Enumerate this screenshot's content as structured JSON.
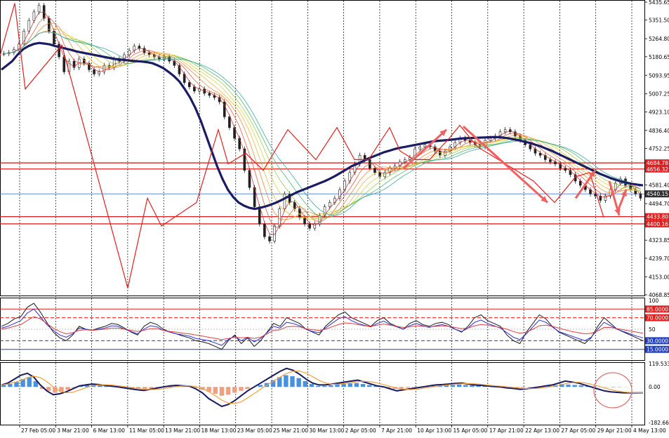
{
  "colors": {
    "background": "#ffffff",
    "grid": "#000000",
    "level_red": "#e02020",
    "zigzag": "#e02020",
    "arrow": "#f06060",
    "ma_slow": "#1c1c64",
    "price_line": "#4a78d8",
    "rsi_fast": "#1a1a1a",
    "rsi_mid": "#3030d0",
    "rsi_slow": "#e04040",
    "macd_line": "#1a1a60",
    "signal_line": "#f0a040",
    "hist_pos": "#4a90e0",
    "hist_neg": "#f0a080",
    "circle": "#e07070"
  },
  "chart_data": [
    {
      "type": "candlestick",
      "panel": "main",
      "ylim": [
        4068.85,
        5435.65
      ],
      "y_ticks": [
        "5435.65",
        "5351.50",
        "5264.80",
        "5180.65",
        "5093.95",
        "5007.25",
        "4923.10",
        "4836.40",
        "4752.25",
        "4665.55",
        "4581.40",
        "4494.70",
        "4410.55",
        "4323.85",
        "4239.70",
        "4153.00",
        "4068.85"
      ],
      "tags": [
        {
          "label": "4684.78",
          "value": 4684.78,
          "style": "red"
        },
        {
          "label": "4656.32",
          "value": 4656.32,
          "style": "red"
        },
        {
          "label": "4540.15",
          "value": 4540.15,
          "style": "dark"
        },
        {
          "label": "4433.80",
          "value": 4433.8,
          "style": "red"
        },
        {
          "label": "4400.16",
          "value": 4400.16,
          "style": "red"
        }
      ],
      "close": [
        5195,
        5200,
        5215,
        5240,
        5300,
        5350,
        5390,
        5420,
        5360,
        5300,
        5240,
        5180,
        5110,
        5160,
        5130,
        5170,
        5150,
        5120,
        5100,
        5110,
        5140,
        5130,
        5170,
        5160,
        5190,
        5210,
        5230,
        5220,
        5200,
        5190,
        5180,
        5170,
        5180,
        5160,
        5140,
        5100,
        5060,
        5040,
        5020,
        5030,
        5010,
        5000,
        4990,
        4970,
        4900,
        4850,
        4800,
        4750,
        4650,
        4570,
        4480,
        4400,
        4340,
        4320,
        4390,
        4470,
        4540,
        4500,
        4470,
        4430,
        4400,
        4380,
        4400,
        4440,
        4480,
        4500,
        4520,
        4560,
        4600,
        4640,
        4680,
        4720,
        4700,
        4660,
        4640,
        4620,
        4640,
        4660,
        4670,
        4690,
        4700,
        4710,
        4750,
        4760,
        4770,
        4760,
        4740,
        4720,
        4740,
        4760,
        4780,
        4800,
        4790,
        4780,
        4770,
        4760,
        4790,
        4800,
        4810,
        4830,
        4840,
        4830,
        4810,
        4790,
        4770,
        4750,
        4730,
        4720,
        4700,
        4690,
        4680,
        4660,
        4650,
        4630,
        4600,
        4580,
        4560,
        4540,
        4530,
        4510,
        4530,
        4560,
        4590,
        4610,
        4580,
        4560,
        4540,
        4520
      ],
      "ma_slow": [
        5120,
        5140,
        5160,
        5190,
        5215,
        5230,
        5240,
        5245,
        5242,
        5238,
        5230,
        5225,
        5218,
        5212,
        5205,
        5200,
        5195,
        5190,
        5185,
        5180,
        5175,
        5170,
        5168,
        5165,
        5162,
        5160,
        5158,
        5155,
        5150,
        5140,
        5128,
        5110,
        5090,
        5065,
        5030,
        4990,
        4940,
        4880,
        4810,
        4740,
        4670,
        4610,
        4560,
        4525,
        4500,
        4485,
        4475,
        4470,
        4475,
        4482,
        4490,
        4500,
        4512,
        4525,
        4538,
        4550,
        4560,
        4570,
        4580,
        4590,
        4600,
        4612,
        4625,
        4640,
        4655,
        4670,
        4680,
        4692,
        4705,
        4715,
        4725,
        4735,
        4742,
        4750,
        4756,
        4760,
        4765,
        4770,
        4775,
        4780,
        4785,
        4788,
        4790,
        4792,
        4795,
        4798,
        4800,
        4801,
        4802,
        4803,
        4804,
        4805,
        4805,
        4803,
        4800,
        4795,
        4790,
        4784,
        4778,
        4770,
        4762,
        4752,
        4742,
        4730,
        4718,
        4706,
        4694,
        4682,
        4670,
        4658,
        4646,
        4634,
        4624,
        4614,
        4606,
        4598,
        4592,
        4587,
        4583,
        4580
      ],
      "zigzag": [
        [
          0,
          5185
        ],
        [
          21,
          5430
        ],
        [
          36,
          5030
        ],
        [
          88,
          5235
        ],
        [
          182,
          4100
        ],
        [
          210,
          4520
        ],
        [
          230,
          4390
        ],
        [
          280,
          4500
        ],
        [
          311,
          4840
        ],
        [
          325,
          4680
        ],
        [
          350,
          4730
        ],
        [
          375,
          4650
        ],
        [
          410,
          4840
        ],
        [
          450,
          4700
        ],
        [
          480,
          4850
        ],
        [
          505,
          4700
        ],
        [
          525,
          4700
        ],
        [
          555,
          4850
        ],
        [
          570,
          4740
        ],
        [
          590,
          4700
        ],
        [
          612,
          4700
        ],
        [
          640,
          4800
        ],
        [
          655,
          4860
        ],
        [
          680,
          4760
        ],
        [
          720,
          4680
        ],
        [
          760,
          4600
        ],
        [
          790,
          4500
        ],
        [
          820,
          4620
        ],
        [
          840,
          4640
        ],
        [
          860,
          4430
        ]
      ],
      "arrows": [
        [
          [
            575,
            4660
          ],
          [
            636,
            4840
          ]
        ],
        [
          [
            660,
            4855
          ],
          [
            780,
            4500
          ]
        ],
        [
          [
            820,
            4520
          ],
          [
            848,
            4650
          ]
        ],
        [
          [
            868,
            4600
          ],
          [
            882,
            4440
          ]
        ],
        [
          [
            880,
            4460
          ],
          [
            892,
            4560
          ]
        ]
      ]
    },
    {
      "type": "line",
      "panel": "rsi",
      "ylim": [
        0,
        100
      ],
      "y_ticks": [
        "100",
        "50"
      ],
      "levels": [
        {
          "label": "85.0000",
          "value": 85,
          "color": "red",
          "dash": false
        },
        {
          "label": "70.0000",
          "value": 70,
          "color": "red",
          "dash": true
        },
        {
          "label": "30.0000",
          "value": 30,
          "color": "blue",
          "dash": true
        },
        {
          "label": "15.0000",
          "value": 15,
          "color": "blue",
          "dash": false
        }
      ],
      "series": [
        {
          "values": [
            55,
            60,
            68,
            72,
            88,
            95,
            80,
            62,
            45,
            35,
            30,
            40,
            55,
            50,
            48,
            52,
            55,
            60,
            58,
            52,
            45,
            40,
            55,
            62,
            58,
            50,
            45,
            42,
            38,
            35,
            30,
            28,
            25,
            20,
            15,
            30,
            40,
            25,
            35,
            20,
            30,
            45,
            60,
            55,
            70,
            65,
            60,
            50,
            45,
            40,
            55,
            65,
            75,
            80,
            70,
            65,
            60,
            55,
            65,
            70,
            60,
            55,
            50,
            60,
            65,
            58,
            55,
            60,
            62,
            58,
            50,
            45,
            55,
            70,
            75,
            65,
            60,
            55,
            40,
            30,
            25,
            45,
            60,
            75,
            68,
            55,
            45,
            40,
            35,
            30,
            25,
            35,
            55,
            70,
            60,
            50,
            45,
            40,
            35,
            30
          ]
        },
        {
          "values": [
            52,
            55,
            60,
            65,
            78,
            85,
            72,
            58,
            48,
            40,
            36,
            42,
            52,
            50,
            48,
            50,
            52,
            56,
            55,
            50,
            46,
            42,
            50,
            56,
            54,
            48,
            45,
            42,
            40,
            38,
            34,
            32,
            30,
            26,
            22,
            32,
            38,
            30,
            36,
            28,
            34,
            44,
            55,
            52,
            62,
            60,
            56,
            50,
            46,
            44,
            52,
            60,
            68,
            72,
            65,
            60,
            57,
            54,
            60,
            64,
            58,
            54,
            50,
            56,
            60,
            56,
            53,
            56,
            58,
            55,
            50,
            46,
            52,
            62,
            66,
            60,
            56,
            52,
            44,
            36,
            32,
            42,
            54,
            66,
            62,
            54,
            46,
            42,
            38,
            34,
            30,
            36,
            50,
            62,
            56,
            50,
            46,
            42,
            38,
            35
          ]
        },
        {
          "values": [
            50,
            52,
            55,
            58,
            65,
            72,
            68,
            60,
            52,
            46,
            42,
            44,
            48,
            49,
            48,
            49,
            50,
            52,
            52,
            50,
            48,
            46,
            48,
            51,
            51,
            48,
            46,
            45,
            43,
            42,
            40,
            38,
            36,
            34,
            32,
            34,
            36,
            35,
            36,
            34,
            36,
            42,
            48,
            49,
            54,
            55,
            54,
            51,
            49,
            48,
            50,
            54,
            58,
            61,
            60,
            58,
            56,
            55,
            57,
            59,
            57,
            55,
            53,
            54,
            56,
            55,
            54,
            55,
            56,
            55,
            53,
            51,
            52,
            56,
            58,
            57,
            55,
            53,
            50,
            46,
            43,
            45,
            50,
            56,
            57,
            55,
            52,
            49,
            46,
            44,
            42,
            43,
            47,
            53,
            53,
            51,
            49,
            47,
            45,
            43
          ]
        }
      ]
    },
    {
      "type": "bar",
      "panel": "macd",
      "ylim": [
        -182.6615,
        119.5334
      ],
      "y_ticks": [
        "119.5334",
        "0.00",
        "-182.6615"
      ],
      "hist": [
        10,
        15,
        25,
        40,
        50,
        30,
        -10,
        -20,
        -30,
        -25,
        -15,
        -5,
        5,
        8,
        10,
        8,
        5,
        2,
        -2,
        -5,
        -8,
        -10,
        -12,
        -8,
        -4,
        0,
        3,
        5,
        4,
        2,
        -5,
        -15,
        -25,
        -35,
        -45,
        -40,
        -30,
        -20,
        -10,
        0,
        10,
        20,
        35,
        50,
        60,
        55,
        45,
        30,
        15,
        5,
        5,
        8,
        12,
        15,
        18,
        20,
        15,
        10,
        5,
        0,
        -5,
        -10,
        -8,
        -5,
        -2,
        0,
        3,
        5,
        7,
        9,
        10,
        12,
        10,
        8,
        6,
        4,
        2,
        0,
        -2,
        -3,
        -5,
        -4,
        -2,
        0,
        2,
        5,
        10,
        15,
        12,
        10,
        8,
        5,
        2,
        0,
        -2,
        -3,
        -2,
        -1,
        0,
        0
      ],
      "macd": [
        10,
        20,
        40,
        60,
        70,
        50,
        10,
        -20,
        -40,
        -35,
        -25,
        -10,
        5,
        10,
        15,
        12,
        8,
        4,
        0,
        -5,
        -10,
        -15,
        -18,
        -12,
        -6,
        0,
        5,
        8,
        6,
        4,
        -10,
        -30,
        -60,
        -80,
        -100,
        -90,
        -70,
        -45,
        -20,
        0,
        20,
        40,
        60,
        80,
        95,
        85,
        65,
        40,
        20,
        10,
        10,
        15,
        20,
        25,
        30,
        35,
        25,
        15,
        5,
        0,
        -10,
        -20,
        -15,
        -10,
        -5,
        0,
        5,
        10,
        12,
        15,
        18,
        20,
        15,
        10,
        8,
        5,
        2,
        0,
        -5,
        -8,
        -12,
        -10,
        -5,
        0,
        5,
        10,
        20,
        30,
        25,
        20,
        10,
        0,
        -10,
        -20,
        -25,
        -28,
        -30,
        -30,
        -30,
        -30
      ]
    }
  ],
  "x_labels": [
    "27 Feb 05:00",
    "3 Mar 21:00",
    "6 Mar 13:00",
    "11 Mar 05:00",
    "13 Mar 21:00",
    "18 Mar 13:00",
    "23 Mar 05:00",
    "25 Mar 21:00",
    "30 Mar 13:00",
    "2 Apr 05:00",
    "7 Apr 21:00",
    "10 Apr 13:00",
    "15 Apr 05:00",
    "17 Apr 21:00",
    "22 Apr 13:00",
    "27 Apr 05:00",
    "29 Apr 21:00",
    "4 May 13:00"
  ]
}
